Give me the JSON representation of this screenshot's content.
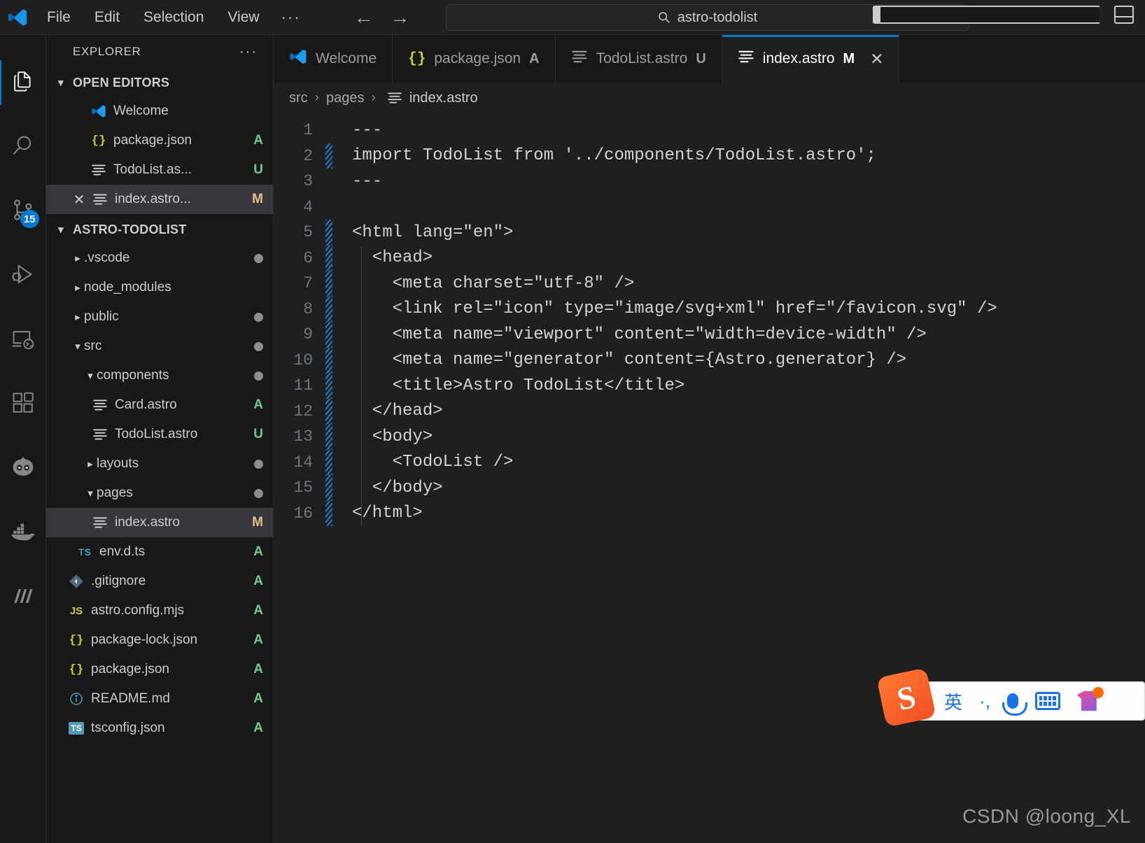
{
  "titlebar": {
    "menus": [
      "File",
      "Edit",
      "Selection",
      "View"
    ],
    "more_label": "···",
    "back_arrow": "←",
    "forward_arrow": "→",
    "search_value": "astro-todolist",
    "search_icon": "search-icon",
    "toggle_sidebar_icon": "layout-sidebar-icon",
    "toggle_panel_icon": "layout-panel-icon"
  },
  "activitybar": {
    "items": [
      {
        "name": "explorer",
        "icon": "files-icon",
        "active": true,
        "badge": ""
      },
      {
        "name": "search",
        "icon": "search-icon",
        "active": false,
        "badge": ""
      },
      {
        "name": "source-control",
        "icon": "source-control-icon",
        "active": false,
        "badge": "15"
      },
      {
        "name": "run-and-debug",
        "icon": "run-debug-icon",
        "active": false,
        "badge": ""
      },
      {
        "name": "remote-explorer",
        "icon": "remote-icon",
        "active": false,
        "badge": ""
      },
      {
        "name": "extensions",
        "icon": "extensions-icon",
        "active": false,
        "badge": ""
      },
      {
        "name": "codegeex",
        "icon": "robot-icon",
        "active": false,
        "badge": ""
      },
      {
        "name": "docker",
        "icon": "docker-icon",
        "active": false,
        "badge": ""
      },
      {
        "name": "marscode",
        "icon": "marscode-icon",
        "active": false,
        "badge": ""
      }
    ]
  },
  "sidebar": {
    "title": "EXPLORER",
    "more_actions": "···",
    "open_editors": {
      "label": "OPEN EDITORS",
      "expanded": true,
      "items": [
        {
          "label": "Welcome",
          "icon": "vscode-icon",
          "status": "",
          "selected": false,
          "close": false
        },
        {
          "label": "package.json",
          "icon": "json-icon",
          "status": "A",
          "selected": false,
          "close": false
        },
        {
          "label": "TodoList.as...",
          "icon": "astro-icon",
          "status": "U",
          "selected": false,
          "close": false
        },
        {
          "label": "index.astro...",
          "icon": "astro-icon",
          "status": "M",
          "selected": true,
          "close": true
        }
      ]
    },
    "project": {
      "label": "ASTRO-TODOLIST",
      "expanded": true,
      "items": [
        {
          "label": ".vscode",
          "type": "folder",
          "expanded": false,
          "indent": 0,
          "status": "dot",
          "selected": false
        },
        {
          "label": "node_modules",
          "type": "folder",
          "expanded": false,
          "indent": 0,
          "status": "",
          "selected": false
        },
        {
          "label": "public",
          "type": "folder",
          "expanded": false,
          "indent": 0,
          "status": "dot",
          "selected": false
        },
        {
          "label": "src",
          "type": "folder",
          "expanded": true,
          "indent": 0,
          "status": "dot",
          "selected": false
        },
        {
          "label": "components",
          "type": "folder",
          "expanded": true,
          "indent": 1,
          "status": "dot",
          "selected": false
        },
        {
          "label": "Card.astro",
          "type": "astro",
          "indent": 2,
          "status": "A",
          "selected": false
        },
        {
          "label": "TodoList.astro",
          "type": "astro",
          "indent": 2,
          "status": "U",
          "selected": false
        },
        {
          "label": "layouts",
          "type": "folder",
          "expanded": false,
          "indent": 1,
          "status": "dot",
          "selected": false
        },
        {
          "label": "pages",
          "type": "folder",
          "expanded": true,
          "indent": 1,
          "status": "dot",
          "selected": false
        },
        {
          "label": "index.astro",
          "type": "astro",
          "indent": 2,
          "status": "M",
          "selected": true
        },
        {
          "label": "env.d.ts",
          "type": "ts",
          "indent": 1,
          "status": "A",
          "selected": false
        },
        {
          "label": ".gitignore",
          "type": "git",
          "indent": 0,
          "status": "A",
          "selected": false
        },
        {
          "label": "astro.config.mjs",
          "type": "js",
          "indent": 0,
          "status": "A",
          "selected": false
        },
        {
          "label": "package-lock.json",
          "type": "json",
          "indent": 0,
          "status": "A",
          "selected": false
        },
        {
          "label": "package.json",
          "type": "json",
          "indent": 0,
          "status": "A",
          "selected": false
        },
        {
          "label": "README.md",
          "type": "md",
          "indent": 0,
          "status": "A",
          "selected": false
        },
        {
          "label": "tsconfig.json",
          "type": "tsjson",
          "indent": 0,
          "status": "A",
          "selected": false
        }
      ]
    }
  },
  "editor": {
    "tabs": [
      {
        "label": "Welcome",
        "icon": "vscode-icon",
        "status": "",
        "active": false,
        "close": false
      },
      {
        "label": "package.json",
        "icon": "json-icon",
        "status": "A",
        "active": false,
        "close": false
      },
      {
        "label": "TodoList.astro",
        "icon": "astro-icon",
        "status": "U",
        "active": false,
        "close": false
      },
      {
        "label": "index.astro",
        "icon": "astro-icon",
        "status": "M",
        "active": true,
        "close": true
      }
    ],
    "breadcrumb": [
      "src",
      "pages",
      "index.astro"
    ],
    "breadcrumb_separator": "›",
    "code_lines": [
      {
        "n": "1",
        "text": "---",
        "changed": false
      },
      {
        "n": "2",
        "text": "import TodoList from '../components/TodoList.astro';",
        "changed": true
      },
      {
        "n": "3",
        "text": "---",
        "changed": false
      },
      {
        "n": "4",
        "text": "",
        "changed": false
      },
      {
        "n": "5",
        "text": "<html lang=\"en\">",
        "changed": true
      },
      {
        "n": "6",
        "text": "  <head>",
        "changed": true
      },
      {
        "n": "7",
        "text": "    <meta charset=\"utf-8\" />",
        "changed": true
      },
      {
        "n": "8",
        "text": "    <link rel=\"icon\" type=\"image/svg+xml\" href=\"/favicon.svg\" />",
        "changed": true
      },
      {
        "n": "9",
        "text": "    <meta name=\"viewport\" content=\"width=device-width\" />",
        "changed": true
      },
      {
        "n": "10",
        "text": "    <meta name=\"generator\" content={Astro.generator} />",
        "changed": true
      },
      {
        "n": "11",
        "text": "    <title>Astro TodoList</title>",
        "changed": true
      },
      {
        "n": "12",
        "text": "  </head>",
        "changed": true
      },
      {
        "n": "13",
        "text": "  <body>",
        "changed": true
      },
      {
        "n": "14",
        "text": "    <TodoList />",
        "changed": true
      },
      {
        "n": "15",
        "text": "  </body>",
        "changed": true
      },
      {
        "n": "16",
        "text": "</html>",
        "changed": true
      }
    ]
  },
  "ime": {
    "logo_letter": "S",
    "mode_label": "英",
    "punct_label": "·,",
    "mic_icon": "microphone-icon",
    "keyboard_icon": "keyboard-icon",
    "skin_icon": "skin-icon"
  },
  "watermark": "CSDN @loong_XL",
  "colors": {
    "accent": "#0078d4",
    "added": "#73c991",
    "modified": "#e2c08d",
    "bg_editor": "#1f1f1f",
    "bg_sidebar": "#181818"
  }
}
